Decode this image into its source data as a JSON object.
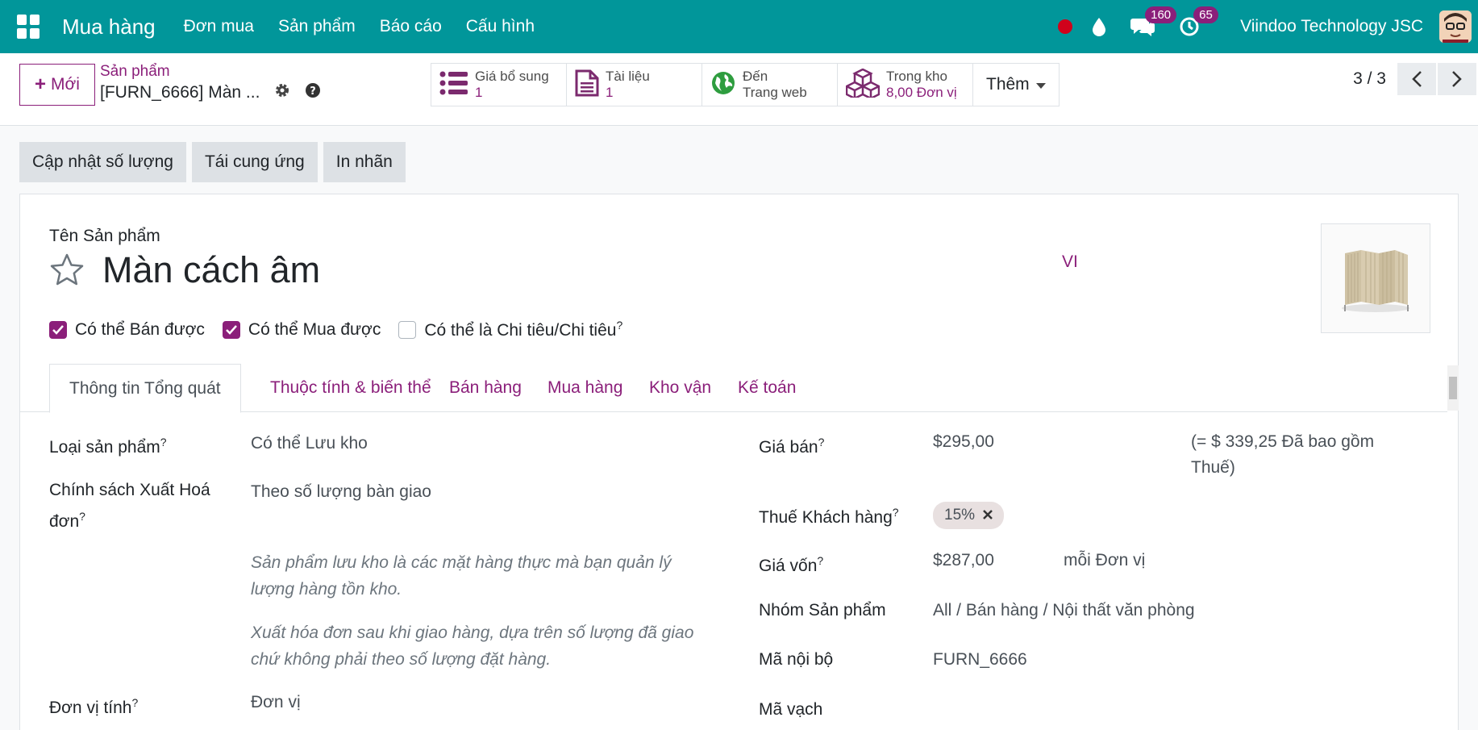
{
  "topbar": {
    "brand": "Mua hàng",
    "menu": [
      "Đơn mua",
      "Sản phẩm",
      "Báo cáo",
      "Cấu hình"
    ],
    "chat_badge": "160",
    "activity_badge": "65",
    "company": "Viindoo Technology JSC"
  },
  "control": {
    "new_label": "Mới",
    "breadcrumb_parent": "Sản phẩm",
    "breadcrumb_current": "[FURN_6666] Màn ...",
    "smart_buttons": [
      {
        "label": "Giá bổ sung",
        "value": "1"
      },
      {
        "label": "Tài liệu",
        "value": "1"
      },
      {
        "label": "Đến",
        "value": "Trang web"
      },
      {
        "label": "Trong kho",
        "value": "8,00 Đơn vị"
      }
    ],
    "more_label": "Thêm",
    "pager": "3 / 3"
  },
  "actions": [
    "Cập nhật số lượng",
    "Tái cung ứng",
    "In nhãn"
  ],
  "sheet": {
    "name_label": "Tên Sản phẩm",
    "title": "Màn cách âm",
    "lang": "VI",
    "checks": [
      {
        "label": "Có thể Bán được",
        "checked": true
      },
      {
        "label": "Có thể Mua được",
        "checked": true
      },
      {
        "label": "Có thể là Chi tiêu/Chi tiêu",
        "checked": false
      }
    ],
    "tabs": [
      "Thông tin Tổng quát",
      "Thuộc tính & biến thể",
      "Bán hàng",
      "Mua hàng",
      "Kho vận",
      "Kế toán"
    ],
    "left": {
      "type_label": "Loại sản phẩm",
      "type_value": "Có thể Lưu kho",
      "invoice_label_1": "Chính sách Xuất Hoá",
      "invoice_label_2": "đơn",
      "invoice_value": "Theo số lượng bàn giao",
      "help1_1": "Sản phẩm lưu kho là các mặt hàng thực mà bạn quản lý",
      "help1_2": "lượng hàng tồn kho.",
      "help2_1": "Xuất hóa đơn sau khi giao hàng, dựa trên số lượng đã giao",
      "help2_2": "chứ không phải theo số lượng đặt hàng.",
      "uom_label": "Đơn vị tính",
      "uom_value": "Đơn vị"
    },
    "right": {
      "price_label": "Giá bán",
      "price_value": "$295,00",
      "price_tax_1": "(= $ 339,25 Đã bao gồm",
      "price_tax_2": "Thuế)",
      "tax_label": "Thuế Khách hàng",
      "tax_tag": "15%",
      "cost_label": "Giá vốn",
      "cost_value": "$287,00",
      "cost_unit": "mỗi Đơn vị",
      "categ_label": "Nhóm Sản phẩm",
      "categ_value": "All / Bán hàng / Nội thất văn phòng",
      "ref_label": "Mã nội bộ",
      "ref_value": "FURN_6666",
      "barcode_label": "Mã vạch"
    }
  }
}
